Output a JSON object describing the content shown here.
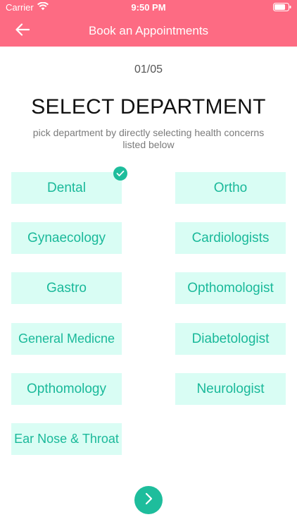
{
  "status_bar": {
    "carrier": "Carrier",
    "time": "9:50 PM"
  },
  "nav": {
    "title": "Book an Appointments",
    "back_icon": "arrow-left-icon"
  },
  "step": "01/05",
  "heading": "SELECT DEPARTMENT",
  "subtitle": "pick department by directly selecting health concerns listed below",
  "departments": [
    {
      "label": "Dental",
      "selected": true
    },
    {
      "label": "Ortho",
      "selected": false
    },
    {
      "label": "Gynaecology",
      "selected": false
    },
    {
      "label": "Cardiologists",
      "selected": false
    },
    {
      "label": "Gastro",
      "selected": false
    },
    {
      "label": "Opthomologist",
      "selected": false
    },
    {
      "label": "General Medicne",
      "selected": false
    },
    {
      "label": "Diabetologist",
      "selected": false
    },
    {
      "label": "Opthomology",
      "selected": false
    },
    {
      "label": "Neurologist",
      "selected": false
    },
    {
      "label": "Ear Nose & Throat",
      "selected": false
    }
  ],
  "colors": {
    "header": "#fd6b83",
    "tile_bg": "#d9fdf4",
    "tile_text": "#1ab99a",
    "accent": "#1ebd9c"
  },
  "next_icon": "chevron-right-icon"
}
